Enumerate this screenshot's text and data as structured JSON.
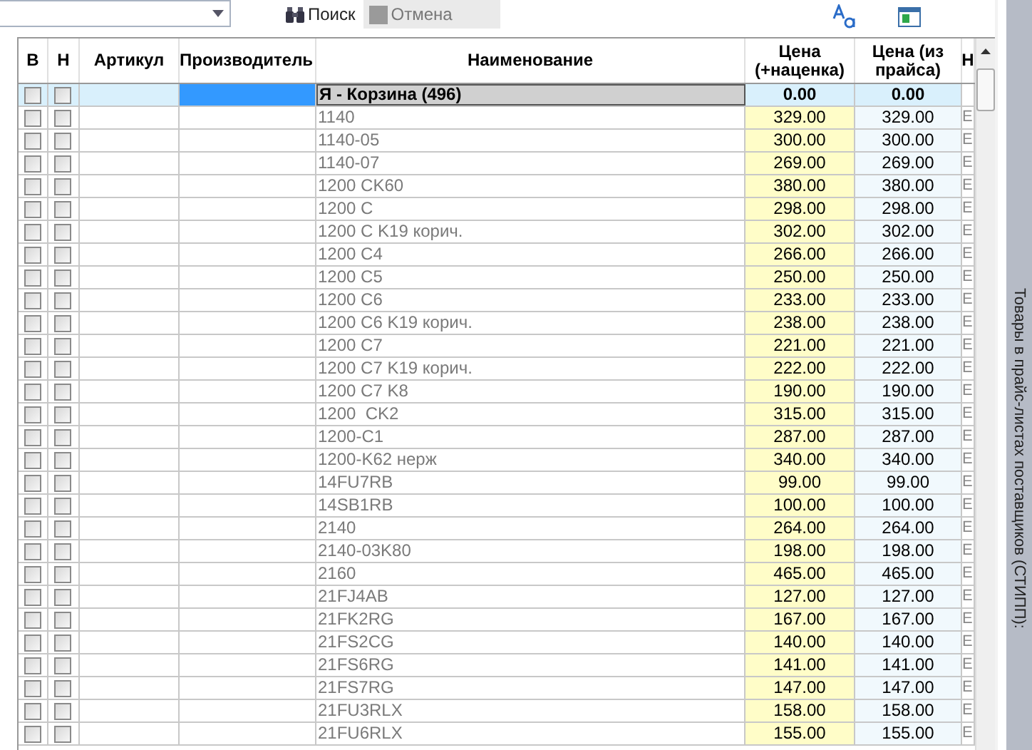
{
  "toolbar": {
    "search_button": "Поиск",
    "cancel_button": {
      "label": "Отмена",
      "disabled": true
    }
  },
  "table": {
    "columns": [
      "В",
      "Н",
      "Артикул",
      "Производитель",
      "Наименование",
      "Цена (+наценка)",
      "Цена (из прайса)",
      "Н"
    ],
    "group_row": {
      "name": "Я - Корзина (496)",
      "price": "0.00",
      "price_list": "0.00",
      "selected": true,
      "b_checked": false,
      "n_checked": false
    },
    "rows": [
      {
        "name": "1140",
        "price": "329.00",
        "price_list": "329.00",
        "col_8": "E",
        "b_checked": false,
        "n_checked": false
      },
      {
        "name": "1140-05",
        "price": "300.00",
        "price_list": "300.00",
        "col_8": "E",
        "b_checked": false,
        "n_checked": false
      },
      {
        "name": "1140-07",
        "price": "269.00",
        "price_list": "269.00",
        "col_8": "E",
        "b_checked": false,
        "n_checked": false
      },
      {
        "name": "1200 CK60",
        "price": "380.00",
        "price_list": "380.00",
        "col_8": "E",
        "b_checked": false,
        "n_checked": false
      },
      {
        "name": "1200 C",
        "price": "298.00",
        "price_list": "298.00",
        "col_8": "E",
        "b_checked": false,
        "n_checked": false
      },
      {
        "name": "1200 C K19 корич.",
        "price": "302.00",
        "price_list": "302.00",
        "col_8": "E",
        "b_checked": false,
        "n_checked": false
      },
      {
        "name": "1200 C4",
        "price": "266.00",
        "price_list": "266.00",
        "col_8": "E",
        "b_checked": false,
        "n_checked": false
      },
      {
        "name": "1200 C5",
        "price": "250.00",
        "price_list": "250.00",
        "col_8": "E",
        "b_checked": false,
        "n_checked": false
      },
      {
        "name": "1200 C6",
        "price": "233.00",
        "price_list": "233.00",
        "col_8": "E",
        "b_checked": false,
        "n_checked": false
      },
      {
        "name": "1200 C6 K19 корич.",
        "price": "238.00",
        "price_list": "238.00",
        "col_8": "E",
        "b_checked": false,
        "n_checked": false
      },
      {
        "name": "1200 C7",
        "price": "221.00",
        "price_list": "221.00",
        "col_8": "E",
        "b_checked": false,
        "n_checked": false
      },
      {
        "name": "1200 C7 K19 корич.",
        "price": "222.00",
        "price_list": "222.00",
        "col_8": "E",
        "b_checked": false,
        "n_checked": false
      },
      {
        "name": "1200 C7 K8",
        "price": "190.00",
        "price_list": "190.00",
        "col_8": "E",
        "b_checked": false,
        "n_checked": false
      },
      {
        "name": "1200  CK2",
        "price": "315.00",
        "price_list": "315.00",
        "col_8": "E",
        "b_checked": false,
        "n_checked": false
      },
      {
        "name": "1200-C1",
        "price": "287.00",
        "price_list": "287.00",
        "col_8": "E",
        "b_checked": false,
        "n_checked": false
      },
      {
        "name": "1200-K62 нерж",
        "price": "340.00",
        "price_list": "340.00",
        "col_8": "E",
        "b_checked": false,
        "n_checked": false
      },
      {
        "name": "14FU7RB",
        "price": "99.00",
        "price_list": "99.00",
        "col_8": "E",
        "b_checked": false,
        "n_checked": false
      },
      {
        "name": "14SB1RB",
        "price": "100.00",
        "price_list": "100.00",
        "col_8": "E",
        "b_checked": false,
        "n_checked": false
      },
      {
        "name": "2140",
        "price": "264.00",
        "price_list": "264.00",
        "col_8": "E",
        "b_checked": false,
        "n_checked": false
      },
      {
        "name": "2140-03K80",
        "price": "198.00",
        "price_list": "198.00",
        "col_8": "E",
        "b_checked": false,
        "n_checked": false
      },
      {
        "name": "2160",
        "price": "465.00",
        "price_list": "465.00",
        "col_8": "E",
        "b_checked": false,
        "n_checked": false
      },
      {
        "name": "21FJ4AB",
        "price": "127.00",
        "price_list": "127.00",
        "col_8": "E",
        "b_checked": false,
        "n_checked": false
      },
      {
        "name": "21FK2RG",
        "price": "167.00",
        "price_list": "167.00",
        "col_8": "E",
        "b_checked": false,
        "n_checked": false
      },
      {
        "name": "21FS2CG",
        "price": "140.00",
        "price_list": "140.00",
        "col_8": "E",
        "b_checked": false,
        "n_checked": false
      },
      {
        "name": "21FS6RG",
        "price": "141.00",
        "price_list": "141.00",
        "col_8": "E",
        "b_checked": false,
        "n_checked": false
      },
      {
        "name": "21FS7RG",
        "price": "147.00",
        "price_list": "147.00",
        "col_8": "E",
        "b_checked": false,
        "n_checked": false
      },
      {
        "name": "21FU3RLX",
        "price": "158.00",
        "price_list": "158.00",
        "col_8": "E",
        "b_checked": false,
        "n_checked": false
      },
      {
        "name": "21FU6RLX",
        "price": "155.00",
        "price_list": "155.00",
        "col_8": "E",
        "b_checked": false,
        "n_checked": false
      }
    ]
  },
  "side_panel": {
    "title": "Товары в прайс-листах поставщиков (СТИПП):"
  }
}
